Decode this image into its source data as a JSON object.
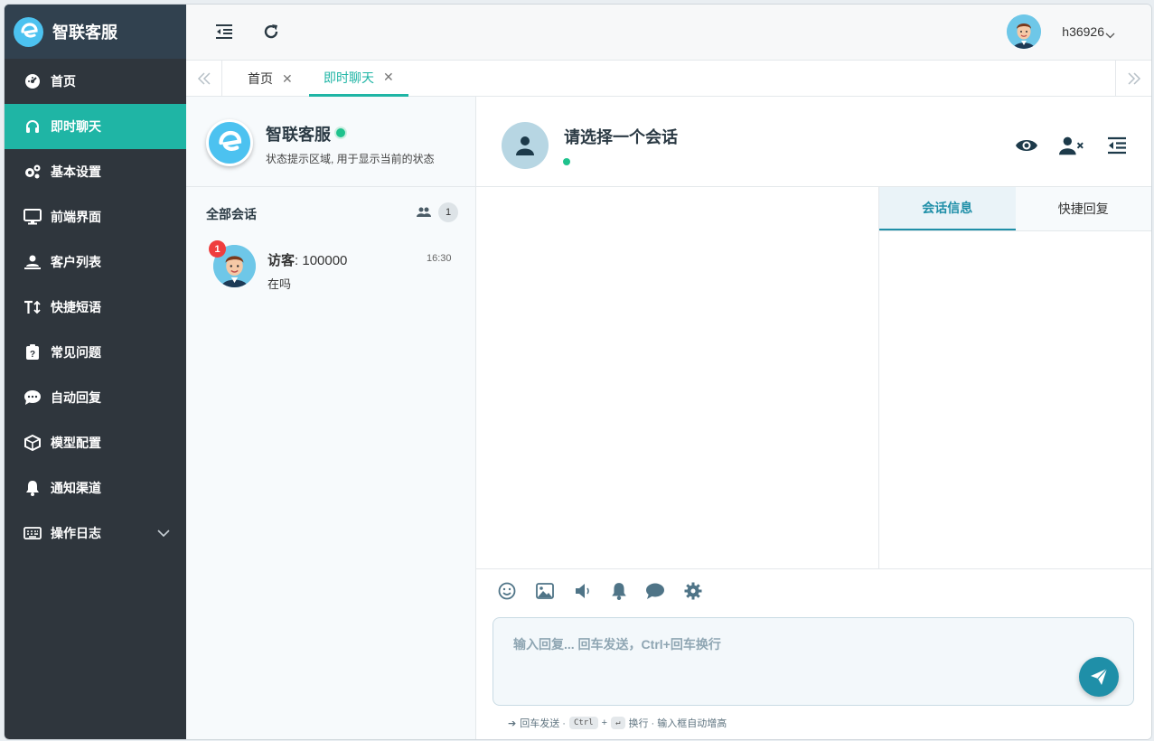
{
  "brand": {
    "title": "智联客服"
  },
  "sidebar": {
    "items": [
      {
        "label": "首页",
        "icon": "dashboard-icon",
        "active": false
      },
      {
        "label": "即时聊天",
        "icon": "headset-icon",
        "active": true
      },
      {
        "label": "基本设置",
        "icon": "gears-icon",
        "active": false
      },
      {
        "label": "前端界面",
        "icon": "monitor-icon",
        "active": false
      },
      {
        "label": "客户列表",
        "icon": "user-list-icon",
        "active": false
      },
      {
        "label": "快捷短语",
        "icon": "text-size-icon",
        "active": false
      },
      {
        "label": "常见问题",
        "icon": "question-icon",
        "active": false
      },
      {
        "label": "自动回复",
        "icon": "comment-dots-icon",
        "active": false
      },
      {
        "label": "模型配置",
        "icon": "cube-icon",
        "active": false
      },
      {
        "label": "通知渠道",
        "icon": "bell-icon",
        "active": false
      },
      {
        "label": "操作日志",
        "icon": "keyboard-icon",
        "active": false,
        "expandable": true
      }
    ]
  },
  "topbar": {
    "username": "h36926"
  },
  "tabs": [
    {
      "label": "首页",
      "active": false
    },
    {
      "label": "即时聊天",
      "active": true
    }
  ],
  "agent": {
    "name": "智联客服",
    "status_text": "状态提示区域, 用于显示当前的状态"
  },
  "conversations": {
    "header": "全部会话",
    "count": "1",
    "items": [
      {
        "badge": "1",
        "name_label": "访客",
        "name_id": ": 100000",
        "time": "16:30",
        "last_message": "在吗"
      }
    ]
  },
  "chat": {
    "title": "请选择一个会话",
    "info_tabs": [
      "会话信息",
      "快捷回复"
    ],
    "input_placeholder": "输入回复... 回车发送，Ctrl+回车换行",
    "hint": {
      "send": "回车发送 ·",
      "key_ctrl": "Ctrl",
      "plus": "+",
      "key_enter": "↵",
      "newline": "换行 · 输入框自动增高"
    }
  },
  "colors": {
    "accent": "#1fb5a5",
    "sidebar_bg": "#2f363d",
    "brand_bg": "#31414f",
    "primary": "#1f8fa8",
    "online": "#1fc28d",
    "badge": "#ef3e3e"
  }
}
